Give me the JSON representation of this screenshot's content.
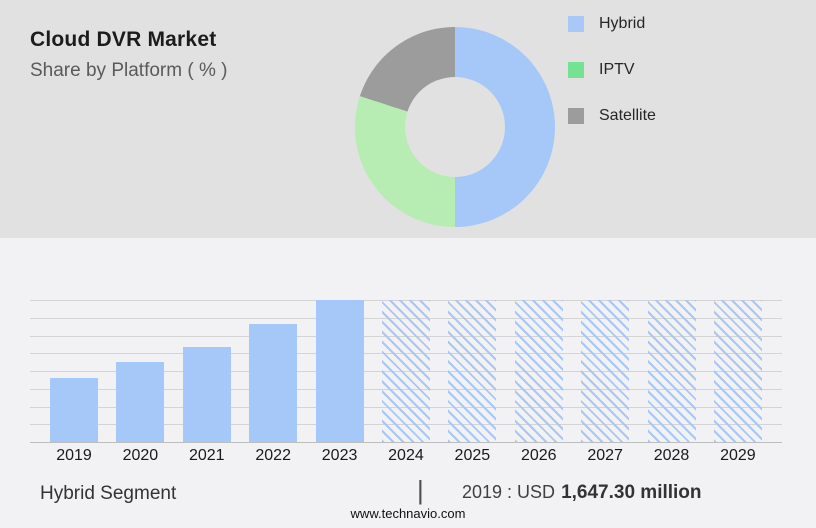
{
  "header": {
    "title": "Cloud DVR Market",
    "subtitle": "Share by Platform ( % )"
  },
  "legend": {
    "items": [
      {
        "label": "Hybrid",
        "color": "#a9c7f7"
      },
      {
        "label": "IPTV",
        "color": "#74e290"
      },
      {
        "label": "Satellite",
        "color": "#9c9c9c"
      }
    ]
  },
  "colors": {
    "header_bg": "#e1e1e1",
    "lower_bg": "#f2f2f4",
    "gridline": "#d4d4d4",
    "axisline": "#bdbdbd"
  },
  "chart_data": [
    {
      "type": "pie",
      "subtype": "donut",
      "title": "Cloud DVR Market — Share by Platform ( % )",
      "labels": [
        "Hybrid",
        "IPTV",
        "Satellite"
      ],
      "values": [
        50,
        30,
        20
      ],
      "colors": [
        "#a6c8f8",
        "#b7ecb2",
        "#9c9c9c"
      ],
      "legend_position": "right",
      "start_angle_deg": 0,
      "direction": "clockwise"
    },
    {
      "type": "bar",
      "title": "Hybrid Segment — market size by year",
      "categories": [
        "2019",
        "2020",
        "2021",
        "2022",
        "2023",
        "2024",
        "2025",
        "2026",
        "2027",
        "2028",
        "2029"
      ],
      "values": [
        45,
        56,
        67,
        83,
        100,
        100,
        100,
        100,
        100,
        100,
        100
      ],
      "value_unit": "percent of chart height (2019–2023 actuals rising; 2024–2029 forecast shown as full-height hatched placeholders)",
      "forecast_categories": [
        "2024",
        "2025",
        "2026",
        "2027",
        "2028",
        "2029"
      ],
      "known_point": {
        "year": "2019",
        "value": "USD 1,647.30 million"
      },
      "bar_color": "#a6c8f8",
      "hatch_color": "#a9c7f3",
      "ylim": [
        0,
        100
      ],
      "grid_divisions": 8,
      "grid": true,
      "y_tick_labels": []
    }
  ],
  "bottom": {
    "segment_label": "Hybrid Segment",
    "separator": "|",
    "value_prefix": "2019 : USD",
    "value_bold": "1,647.30 million"
  },
  "footer": {
    "url": "www.technavio.com"
  }
}
